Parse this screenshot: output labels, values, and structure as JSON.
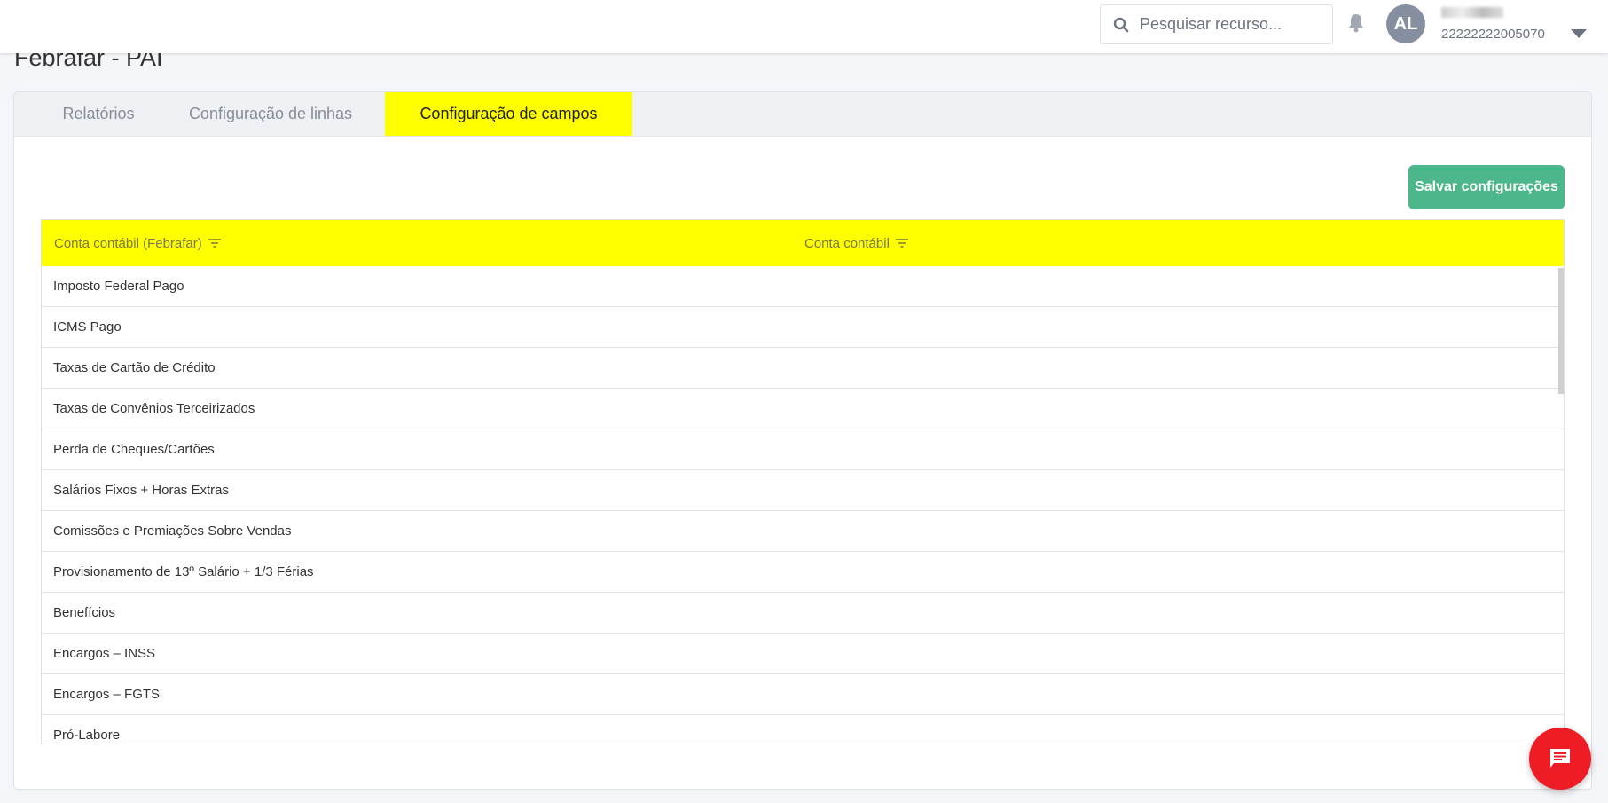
{
  "header": {
    "search_placeholder": "Pesquisar recurso...",
    "avatar_initials": "AL",
    "user_id": "22222222005070"
  },
  "page": {
    "title": "Febrafar - PAI"
  },
  "tabs": [
    {
      "label": "Relatórios"
    },
    {
      "label": "Configuração de linhas"
    },
    {
      "label": "Configuração de campos",
      "active": true
    }
  ],
  "toolbar": {
    "save_label": "Salvar configurações"
  },
  "table": {
    "columns": [
      "Conta contábil (Febrafar)",
      "Conta contábil"
    ],
    "rows": [
      "Imposto Federal Pago",
      "ICMS Pago",
      "Taxas de Cartão de Crédito",
      "Taxas de Convênios Terceirizados",
      "Perda de Cheques/Cartões",
      "Salários Fixos + Horas Extras",
      "Comissões e Premiações Sobre Vendas",
      "Provisionamento de 13º Salário + 1/3 Férias",
      "Benefícios",
      "Encargos – INSS",
      "Encargos – FGTS",
      "Pró-Labore"
    ]
  },
  "colors": {
    "accent": "#ffff00",
    "save": "#4db78c",
    "chat": "#ee1c25"
  }
}
